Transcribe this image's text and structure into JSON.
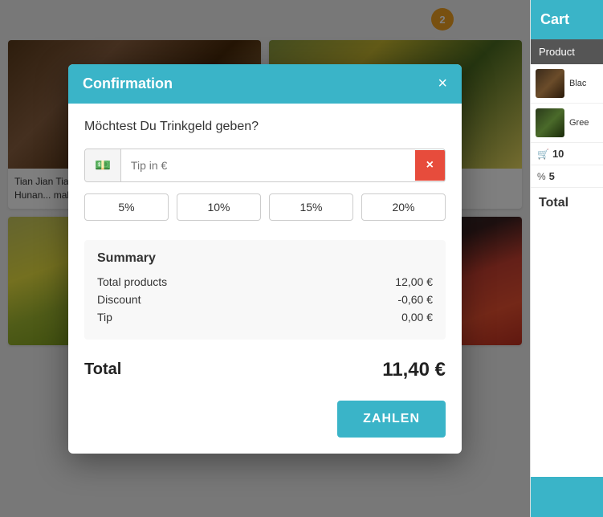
{
  "cart": {
    "title": "Cart",
    "product_label": "Product",
    "badge_count": "2",
    "items": [
      {
        "name": "Blac",
        "img_type": "black"
      },
      {
        "name": "Gree",
        "img_type": "green"
      }
    ],
    "qty_value": "10",
    "discount_value": "5",
    "total_label": "Total"
  },
  "modal": {
    "title": "Confirmation",
    "close_label": "×",
    "question": "Möchtest Du Trinkgeld geben?",
    "tip_placeholder": "Tip in €",
    "clear_btn": "×",
    "percent_buttons": [
      "5%",
      "10%",
      "15%",
      "20%"
    ],
    "summary_title": "Summary",
    "rows": [
      {
        "label": "Total products",
        "value": "12,00 €"
      },
      {
        "label": "Discount",
        "value": "-0,60 €"
      },
      {
        "label": "Tip",
        "value": "0,00 €"
      }
    ],
    "total_label": "Total",
    "total_value": "11,40 €",
    "pay_button_label": "ZAHLEN"
  },
  "products": [
    {
      "title": "Tian Jian Tia... tea' in Chine... grade of dark... from Hunan... making s...",
      "img_type": "tea"
    },
    {
      "title": "",
      "img_type": "chamomile"
    },
    {
      "title": "",
      "img_type": "rosehip"
    }
  ]
}
